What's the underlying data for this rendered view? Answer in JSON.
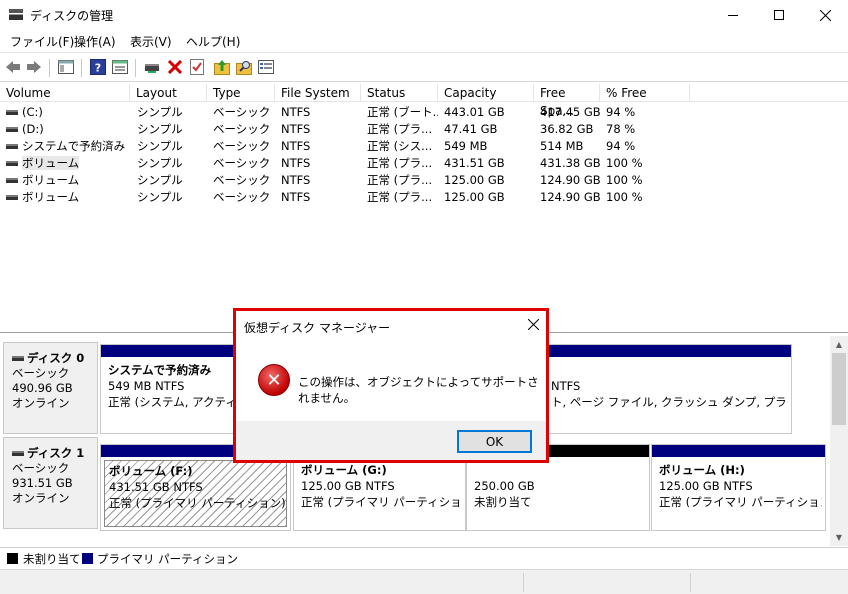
{
  "window": {
    "title": "ディスクの管理"
  },
  "menu": [
    "ファイル(F)",
    "操作(A)",
    "表示(V)",
    "ヘルプ(H)"
  ],
  "toolbar_icons": [
    "back-arrow-icon",
    "forward-arrow-icon",
    "console-tree-icon",
    "help-icon",
    "properties-icon",
    "connect-drive-icon",
    "delete-icon",
    "check-icon",
    "up-folder-icon",
    "search-folder-icon",
    "list-view-icon"
  ],
  "volume_list": {
    "columns": [
      "Volume",
      "Layout",
      "Type",
      "File System",
      "Status",
      "Capacity",
      "Free Spa...",
      "% Free"
    ],
    "rows": [
      [
        "(C:)",
        "シンプル",
        "ベーシック",
        "NTFS",
        "正常 (ブート...",
        "443.01 GB",
        "417.45 GB",
        "94 %"
      ],
      [
        "(D:)",
        "シンプル",
        "ベーシック",
        "NTFS",
        "正常 (プラ...",
        "47.41 GB",
        "36.82 GB",
        "78 %"
      ],
      [
        "システムで予約済み",
        "シンプル",
        "ベーシック",
        "NTFS",
        "正常 (シス...",
        "549 MB",
        "514 MB",
        "94 %"
      ],
      [
        "ボリューム",
        "シンプル",
        "ベーシック",
        "NTFS",
        "正常 (プラ...",
        "431.51 GB",
        "431.38 GB",
        "100 %"
      ],
      [
        "ボリューム",
        "シンプル",
        "ベーシック",
        "NTFS",
        "正常 (プラ...",
        "125.00 GB",
        "124.90 GB",
        "100 %"
      ],
      [
        "ボリューム",
        "シンプル",
        "ベーシック",
        "NTFS",
        "正常 (プラ...",
        "125.00 GB",
        "124.90 GB",
        "100 %"
      ]
    ]
  },
  "disks": [
    {
      "name": "ディスク 0",
      "type": "ベーシック",
      "size": "490.96 GB",
      "state": "オンライン",
      "partitions": [
        {
          "title": "システムで予約済み",
          "size": "549 MB NTFS",
          "status": "正常 (システム, アクティブ, プ"
        },
        {
          "title": "",
          "size": "NTFS",
          "status": "ト, ページ ファイル, クラッシュ ダンプ, プライマリ パーテ"
        }
      ]
    },
    {
      "name": "ディスク 1",
      "type": "ベーシック",
      "size": "931.51 GB",
      "state": "オンライン",
      "partitions": [
        {
          "title": "ボリューム  (F:)",
          "size": "431.51 GB NTFS",
          "status": "正常 (プライマリ パーティション)"
        },
        {
          "title": "ボリューム  (G:)",
          "size": "125.00 GB NTFS",
          "status": "正常 (プライマリ パーティション)"
        },
        {
          "title": "",
          "size": "250.00 GB",
          "status": "未割り当て"
        },
        {
          "title": "ボリューム  (H:)",
          "size": "125.00 GB NTFS",
          "status": "正常 (プライマリ パーティション)"
        }
      ]
    }
  ],
  "legend": {
    "unallocated": "未割り当て",
    "primary": "プライマリ パーティション"
  },
  "dialog": {
    "title": "仮想ディスク マネージャー",
    "message": "この操作は、オブジェクトによってサポートされません。",
    "ok_label": "OK",
    "icon": "error-icon"
  },
  "colors": {
    "primary_partition": "#00007f",
    "unallocated": "#000000",
    "dialog_highlight": "#e00000"
  }
}
